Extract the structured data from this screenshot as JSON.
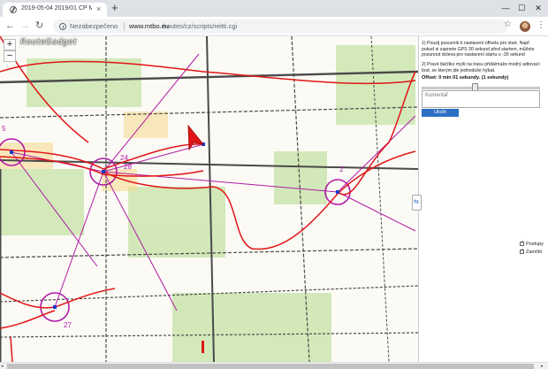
{
  "browser": {
    "tab_title": "2019-05-04 2019/01 ČP MTBO ·",
    "tab_close": "×",
    "new_tab": "+",
    "win_minimize": "—",
    "win_maximize": "☐",
    "win_close": "✕",
    "nav_back": "←",
    "nav_forward": "→",
    "nav_reload": "↻",
    "security_text": "Nezabezpečeno",
    "url_domain": "www.mtbo.eu",
    "url_path": "/routes/cz/scripts/reitti.cgi",
    "star": "☆",
    "menu": "⋮"
  },
  "map": {
    "zoom_in": "+",
    "zoom_out": "−",
    "logo": "RouteGadget",
    "control_labels": {
      "c15": "5",
      "c24": "24",
      "c28": "28",
      "c2": "2",
      "c27": "27"
    }
  },
  "sidebar": {
    "instruction_1": "1) Pouzij posuvník k nastavení offsetu pro start. Např. pokud si zapnete GPS 30 sekund před startem, můžete posunout doleva pro nastavení startu o -30 sekund",
    "instruction_2": "2) Pravé tlačítko myši na trasu přidá/maže modrý adtovací bod, se kterým jde jednoduše hýbat.",
    "offset_label": "Offset: 0 min 01 sekundy. (1 sekundy)",
    "comment_placeholder": "Komentář",
    "save_label": "Uložit",
    "toggle_icon": "⇆",
    "checkbox_postupy": "Postupy",
    "checkbox_zamisti": "Zamíšti"
  },
  "scrollbar": {
    "left_arrow": "◂",
    "right_arrow": "▸"
  },
  "colors": {
    "route_red": "#e01616",
    "course_magenta": "#b01aa6",
    "track_black": "#4a4a4a",
    "green_area": "#c5e3a6",
    "accent_blue": "#2d6fc4"
  }
}
